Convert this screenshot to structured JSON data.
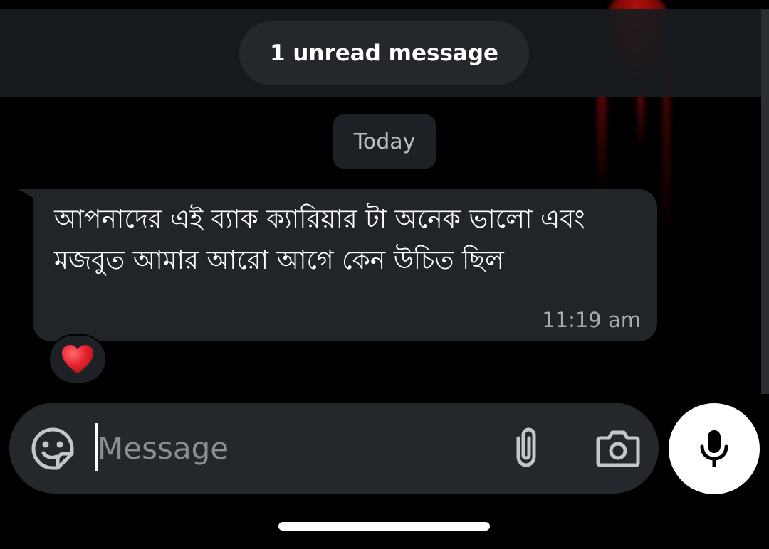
{
  "banner": {
    "unread_label": "1 unread message"
  },
  "date_separator": {
    "label": "Today"
  },
  "message": {
    "text": "আপনাদের এই ব্যাক ক্যারিয়ার টা অনেক ভালো এবং মজবুত আমার আরো আগে কেন উচিত ছিল",
    "time": "11:19 am",
    "reaction": "❤️"
  },
  "composer": {
    "placeholder": "Message",
    "value": ""
  },
  "icons": {
    "emoji": "sticker-smile-icon",
    "attach": "paperclip-icon",
    "camera": "camera-icon",
    "mic": "microphone-icon"
  },
  "colors": {
    "background": "#000000",
    "bubble": "#212529",
    "composer": "#24282c",
    "mic_button": "#ffffff",
    "reaction_heart": "#e8232f"
  }
}
